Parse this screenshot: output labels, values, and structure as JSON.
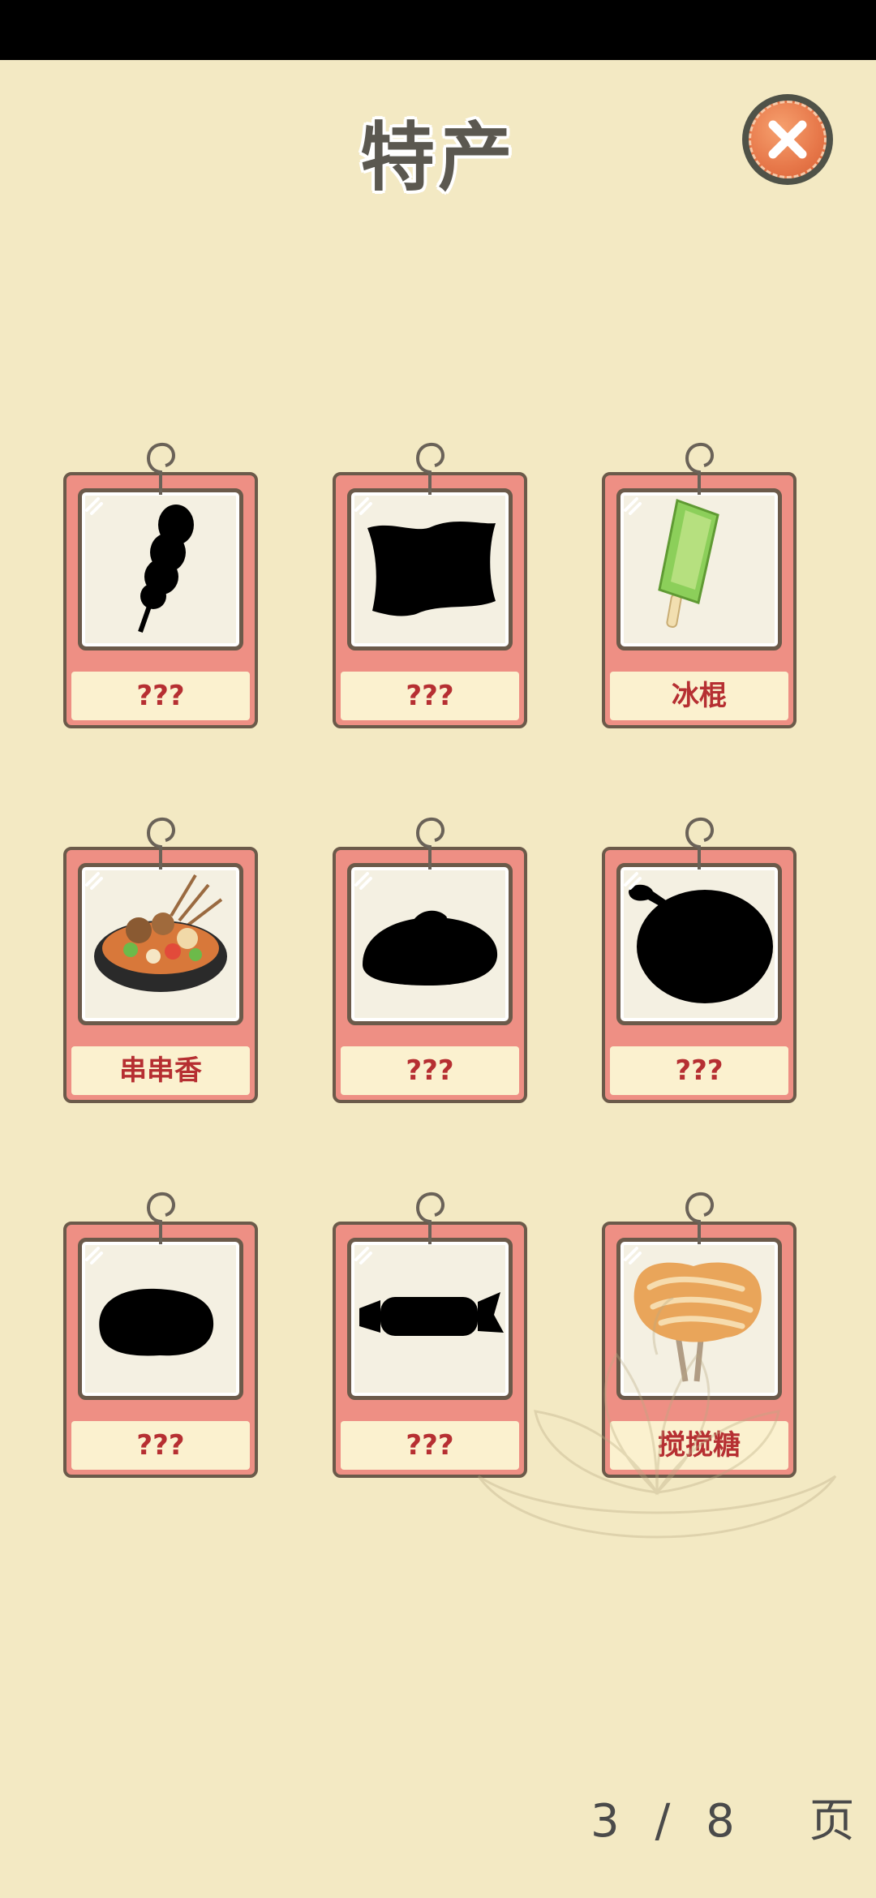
{
  "title": "特产",
  "close_icon": "close-x-icon",
  "cards": [
    {
      "label": "???",
      "icon": "skewer-silhouette-icon",
      "unlocked": false
    },
    {
      "label": "???",
      "icon": "pillow-silhouette-icon",
      "unlocked": false
    },
    {
      "label": "冰棍",
      "icon": "popsicle-icon",
      "unlocked": true
    },
    {
      "label": "串串香",
      "icon": "hotpot-skewers-bowl-icon",
      "unlocked": true
    },
    {
      "label": "???",
      "icon": "bun-silhouette-icon",
      "unlocked": false
    },
    {
      "label": "???",
      "icon": "bowl-spoon-silhouette-icon",
      "unlocked": false
    },
    {
      "label": "???",
      "icon": "cake-silhouette-icon",
      "unlocked": false
    },
    {
      "label": "???",
      "icon": "candy-wrapper-silhouette-icon",
      "unlocked": false
    },
    {
      "label": "搅搅糖",
      "icon": "stirred-candy-icon",
      "unlocked": true
    }
  ],
  "pager": {
    "current": "3",
    "separator": "/",
    "total": "8",
    "unit": "页"
  }
}
